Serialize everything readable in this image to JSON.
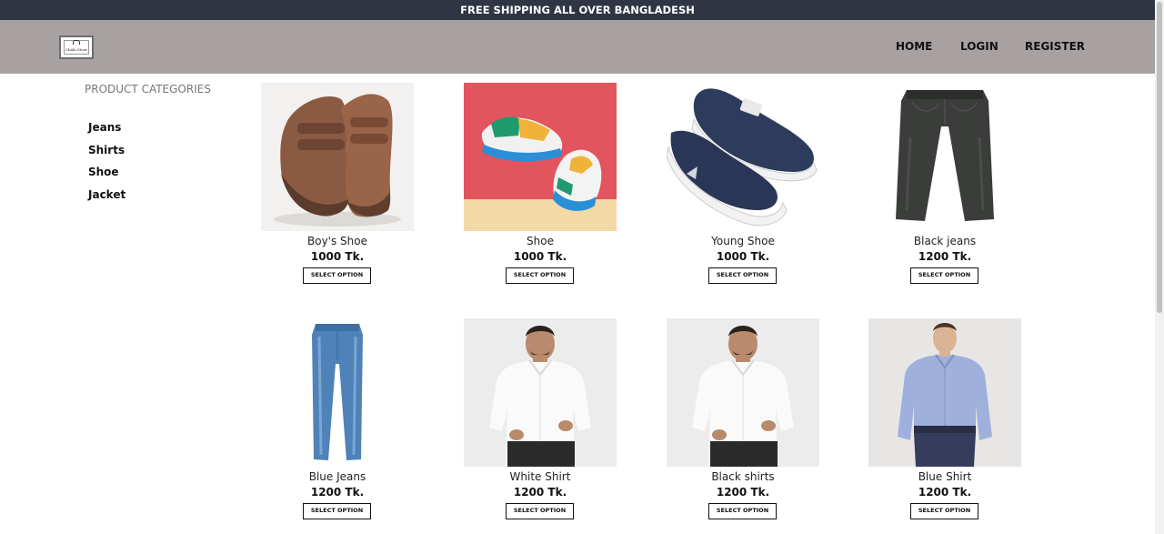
{
  "topbar": {
    "text": "FREE SHIPPING ALL OVER BANGLADESH"
  },
  "header": {
    "logo_text": "Chala Store",
    "nav": [
      {
        "label": "HOME"
      },
      {
        "label": "LOGIN"
      },
      {
        "label": "REGISTER"
      }
    ]
  },
  "sidebar": {
    "title": "PRODUCT CATEGORIES",
    "categories": [
      {
        "label": "Jeans"
      },
      {
        "label": "Shirts"
      },
      {
        "label": "Shoe"
      },
      {
        "label": "Jacket"
      }
    ]
  },
  "products": [
    {
      "name": "Boy's Shoe",
      "price": "1000 Tk.",
      "button": "SELECT OPTION",
      "image": "brown-velcro-shoes"
    },
    {
      "name": "Shoe",
      "price": "1000 Tk.",
      "button": "SELECT OPTION",
      "image": "colorful-sneakers"
    },
    {
      "name": "Young Shoe",
      "price": "1000 Tk.",
      "button": "SELECT OPTION",
      "image": "navy-slip-on-shoes"
    },
    {
      "name": "Black jeans",
      "price": "1200 Tk.",
      "button": "SELECT OPTION",
      "image": "black-jeans"
    },
    {
      "name": "Blue Jeans",
      "price": "1200 Tk.",
      "button": "SELECT OPTION",
      "image": "blue-jeans"
    },
    {
      "name": "White Shirt",
      "price": "1200 Tk.",
      "button": "SELECT OPTION",
      "image": "man-white-shirt"
    },
    {
      "name": "Black shirts",
      "price": "1200 Tk.",
      "button": "SELECT OPTION",
      "image": "man-white-shirt"
    },
    {
      "name": "Blue Shirt",
      "price": "1200 Tk.",
      "button": "SELECT OPTION",
      "image": "man-blue-shirt"
    }
  ],
  "colors": {
    "topbar": "#2f3542",
    "header": "#a7a1a1",
    "text": "#111111"
  }
}
